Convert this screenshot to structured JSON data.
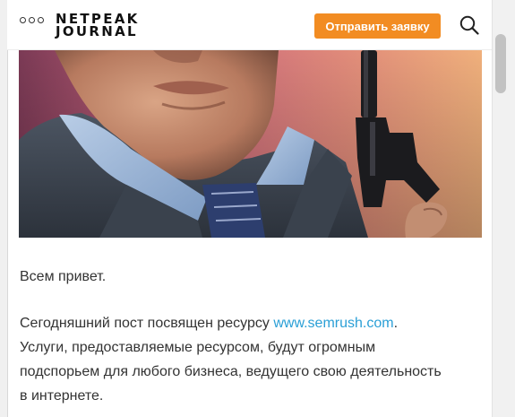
{
  "header": {
    "logo_line1": "NETPEAK",
    "logo_line2": "JOURNAL",
    "cta_label": "Отправить заявку",
    "menu_icon": "more-dots-icon",
    "search_icon": "search-icon"
  },
  "colors": {
    "accent": "#f28c22",
    "link": "#2a9fd6"
  },
  "article": {
    "greeting": "Всем привет.",
    "intro_before_link": "Сегодняшний пост посвящен ресурсу ",
    "link_text": "www.semrush.com",
    "intro_after_link": ".",
    "line2": "Услуги, предоставляемые ресурсом, будут огромным",
    "line3": "подспорьем для любого бизнеса, ведущего свою деятельность",
    "line4": "в интернете."
  }
}
